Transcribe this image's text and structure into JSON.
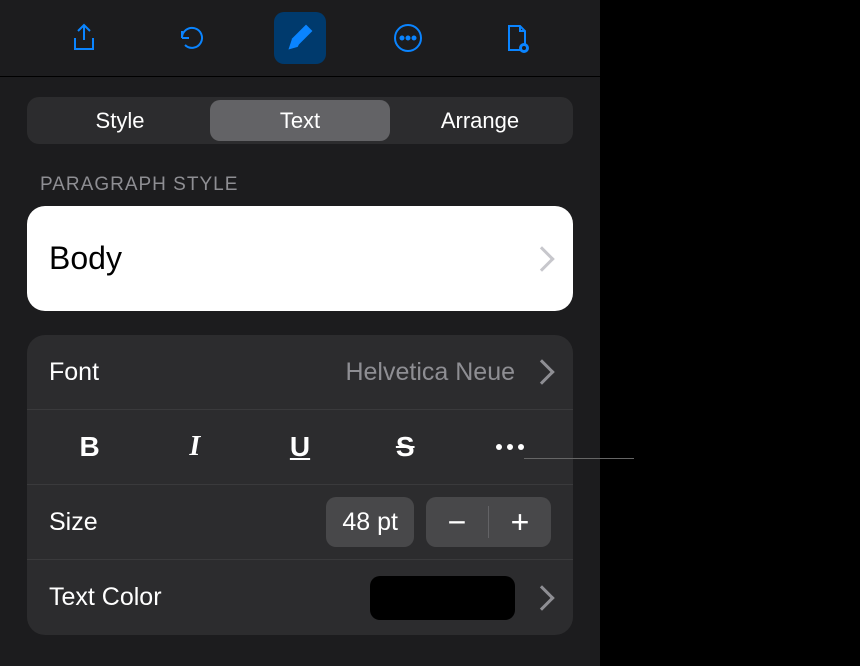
{
  "tabs": {
    "style": "Style",
    "text": "Text",
    "arrange": "Arrange"
  },
  "paragraph_style": {
    "section_label": "PARAGRAPH STYLE",
    "value": "Body"
  },
  "font": {
    "label": "Font",
    "value": "Helvetica Neue"
  },
  "styles": {
    "bold": "B",
    "italic": "I",
    "underline": "U",
    "strike": "S"
  },
  "size": {
    "label": "Size",
    "value": "48 pt",
    "minus": "−",
    "plus": "+"
  },
  "text_color": {
    "label": "Text Color",
    "value": "#000000"
  }
}
